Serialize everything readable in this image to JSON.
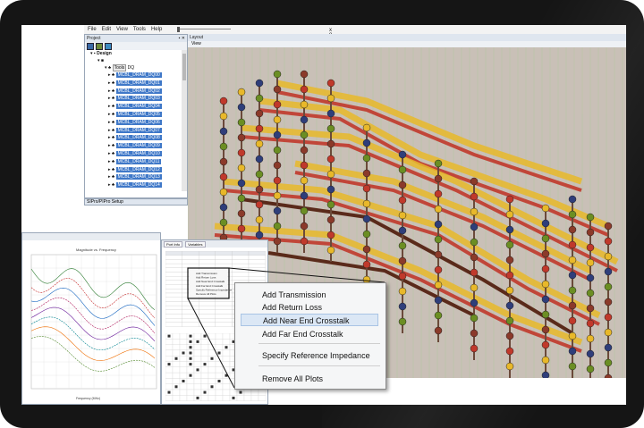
{
  "menubar": {
    "items": [
      "File",
      "Edit",
      "View",
      "Tools",
      "Help"
    ],
    "zoom_value": "x 8"
  },
  "project_panel": {
    "title": "Project",
    "tree": {
      "root": "Design",
      "folder": "DQ",
      "folder_prefix": "Tools",
      "nets": [
        "MCBL_DRAM_DQ00",
        "MCBL_DRAM_DQ01",
        "MCBL_DRAM_DQ02",
        "MCBL_DRAM_DQ03",
        "MCBL_DRAM_DQ04",
        "MCBL_DRAM_DQ05",
        "MCBL_DRAM_DQ06",
        "MCBL_DRAM_DQ07",
        "MCBL_DRAM_DQ08",
        "MCBL_DRAM_DQ09",
        "MCBL_DRAM_DQ10",
        "MCBL_DRAM_DQ11",
        "MCBL_DRAM_DQ12",
        "MCBL_DRAM_DQ13",
        "MCBL_DRAM_DQ14"
      ]
    }
  },
  "setup_panel": {
    "title": "SIPro/PIPro Setup"
  },
  "layout_panel": {
    "title": "Layout",
    "sub": "View"
  },
  "plot_panel": {
    "title": "Magnitude vs. Frequency",
    "xlabel": "Frequency (MHz)"
  },
  "table_panel": {
    "tabs": [
      "Port Info",
      "Variables"
    ]
  },
  "context_menu": {
    "items": [
      {
        "label": "Add Transmission"
      },
      {
        "label": "Add Return Loss"
      },
      {
        "label": "Add Near End Crosstalk"
      },
      {
        "label": "Add Far End Crosstalk"
      },
      {
        "label": "Specify Reference Impedance"
      },
      {
        "label": "Remove All Plots"
      }
    ],
    "hovered_index": 2
  },
  "colors": {
    "selection": "#3f78c8",
    "menu_hover": "#dbe7f5",
    "trace_red": "#c0392b",
    "trace_yellow": "#e8b82a",
    "board": "#c9c0b7"
  }
}
